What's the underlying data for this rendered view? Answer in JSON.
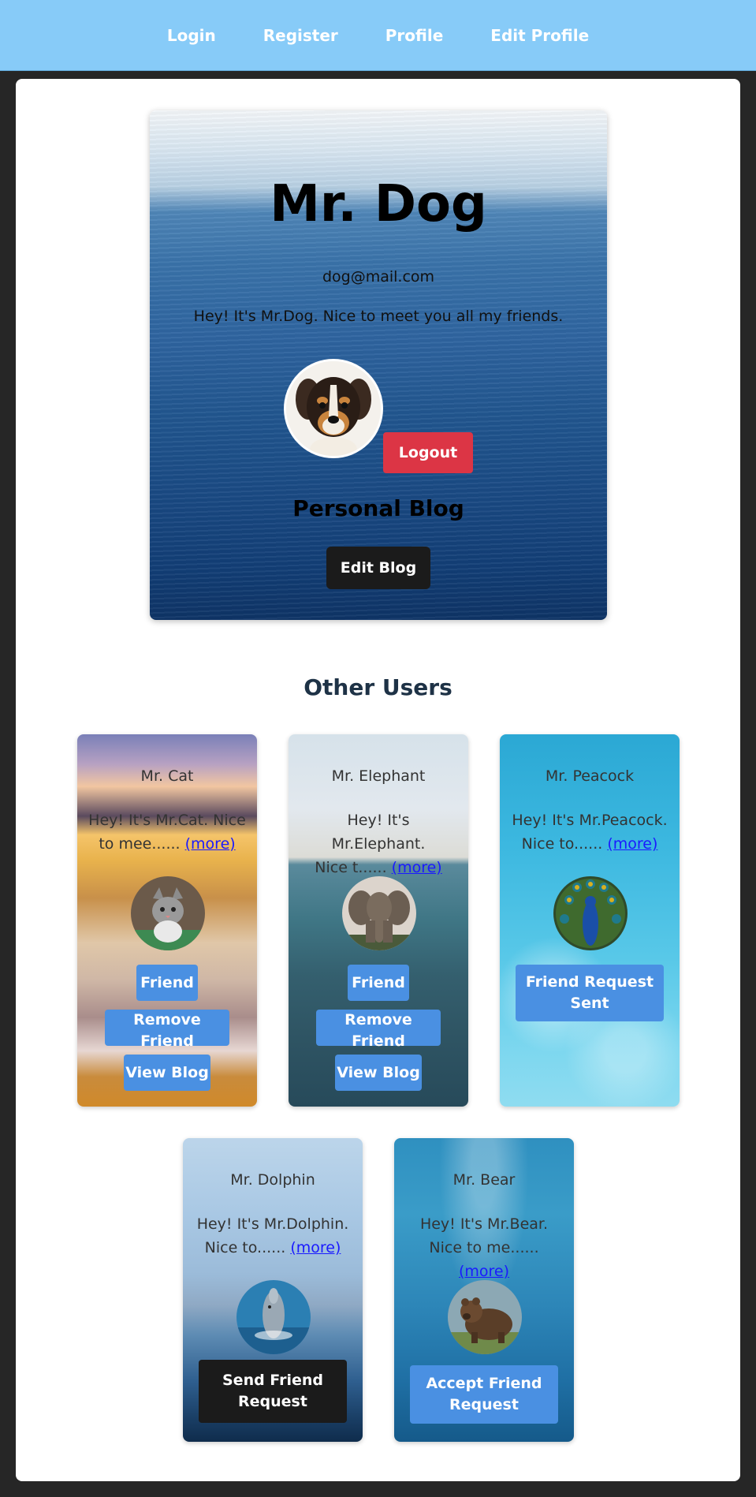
{
  "nav": {
    "links": [
      "Login",
      "Register",
      "Profile",
      "Edit Profile"
    ]
  },
  "profile": {
    "name": "Mr. Dog",
    "email": "dog@mail.com",
    "bio": "Hey! It's Mr.Dog. Nice to meet you all my friends.",
    "logout_label": "Logout",
    "blog_title": "Personal Blog",
    "edit_blog_label": "Edit Blog"
  },
  "other_users": {
    "heading": "Other Users",
    "more_label": "(more)",
    "users": [
      {
        "name": "Mr. Cat",
        "bio_line1": "Hey! It's Mr.Cat. Nice",
        "bio_line2": "to mee......",
        "buttons": [
          "Friend",
          "Remove Friend",
          "View Blog"
        ]
      },
      {
        "name": "Mr. Elephant",
        "bio_line1": "Hey! It's Mr.Elephant.",
        "bio_line2": "Nice t......",
        "buttons": [
          "Friend",
          "Remove Friend",
          "View Blog"
        ]
      },
      {
        "name": "Mr. Peacock",
        "bio_line1": "Hey! It's Mr.Peacock.",
        "bio_line2": "Nice to......",
        "buttons": [
          "Friend Request Sent"
        ]
      },
      {
        "name": "Mr. Dolphin",
        "bio_line1": "Hey! It's Mr.Dolphin.",
        "bio_line2": "Nice to......",
        "buttons": [
          "Send Friend Request"
        ]
      },
      {
        "name": "Mr. Bear",
        "bio_line1": "Hey! It's Mr.Bear.",
        "bio_line2": "Nice to me......",
        "buttons": [
          "Accept Friend Request"
        ]
      }
    ]
  },
  "colors": {
    "navbar": "#87cbf8",
    "danger": "#dc3545",
    "primary_button": "#4a90e2",
    "dark_button": "#1b1b1b",
    "more_link": "#1a1aff"
  },
  "icons": {
    "profile_avatar": "dog-avatar-icon",
    "cat_avatar": "cat-avatar-icon",
    "elephant_avatar": "elephant-avatar-icon",
    "peacock_avatar": "peacock-avatar-icon",
    "dolphin_avatar": "dolphin-avatar-icon",
    "bear_avatar": "bear-avatar-icon"
  }
}
